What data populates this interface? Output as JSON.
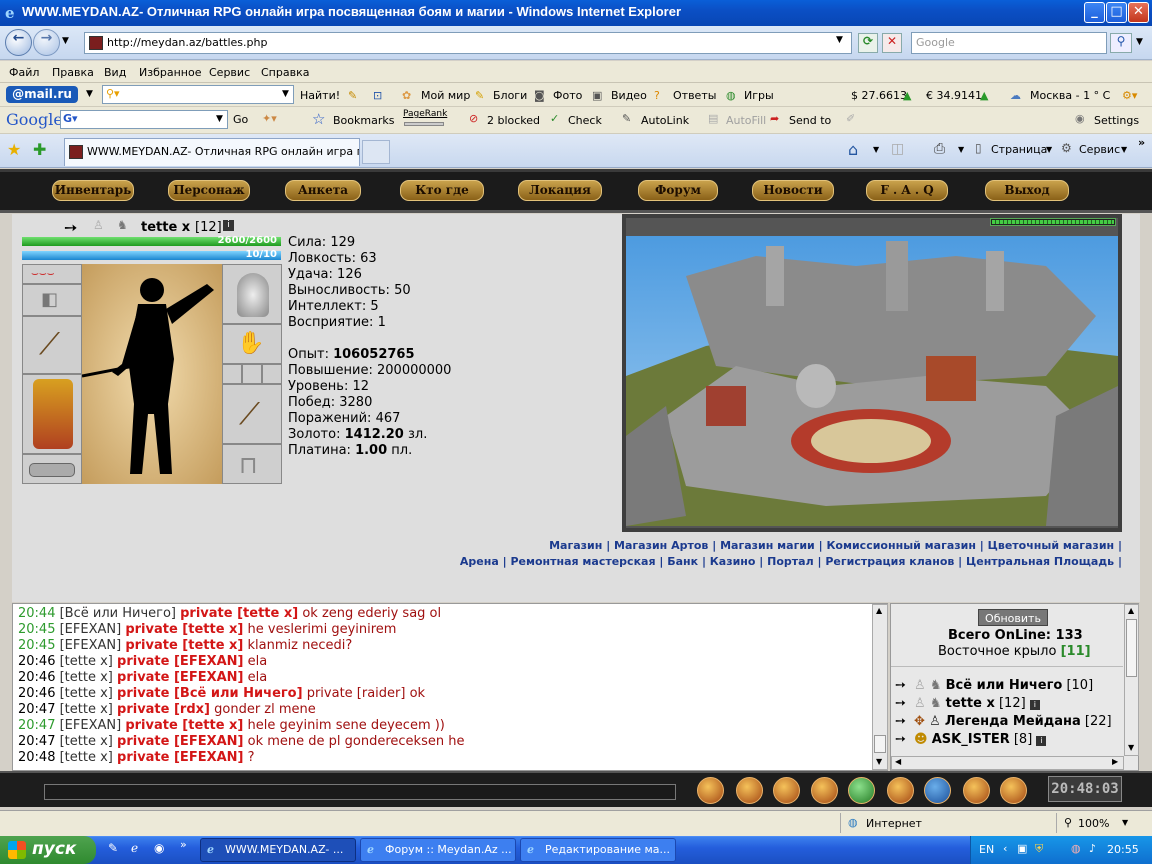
{
  "window": {
    "title": "WWW.MEYDAN.AZ- Отличная RPG онлайн игра посвященная боям и магии - Windows Internet Explorer"
  },
  "address": {
    "url": "http://meydan.az/battles.php",
    "search_placeholder": "Google"
  },
  "menu": [
    "Файл",
    "Правка",
    "Вид",
    "Избранное",
    "Сервис",
    "Справка"
  ],
  "mailru_bar": {
    "logo": "@mail.ru",
    "find_label": "Найти!",
    "items": [
      "Мой мир",
      "Блоги",
      "Фото",
      "Видео",
      "Ответы",
      "Игры"
    ],
    "usd": "$ 27.6613",
    "eur": "€ 34.9141",
    "weather": "Москва  - 1 ° C"
  },
  "google_bar": {
    "logo": "Google",
    "go": "Go",
    "bookmarks": "Bookmarks",
    "pagerank": "PageRank",
    "blocked": "2 blocked",
    "check": "Check",
    "autolink": "AutoLink",
    "autofill": "AutoFill",
    "sendto": "Send to",
    "settings": "Settings"
  },
  "tabs": {
    "active": "WWW.MEYDAN.AZ- Отличная RPG онлайн игра пос...",
    "right_items": [
      "Страница",
      "Сервис"
    ]
  },
  "game_nav": [
    "Инвентарь",
    "Персонаж",
    "Анкета",
    "Кто где",
    "Локация",
    "Форум",
    "Новости",
    "F . A . Q",
    "Выход"
  ],
  "character": {
    "name": "tette x",
    "level": "[12]",
    "hp_text": "2600/2600",
    "mp_text": "10/10",
    "hp_fraction": 1.0,
    "mp_fraction": 1.0,
    "stats": [
      {
        "label": "Сила:",
        "value": "129"
      },
      {
        "label": "Ловкость:",
        "value": "63"
      },
      {
        "label": "Удача:",
        "value": "126"
      },
      {
        "label": "Выносливость:",
        "value": "50"
      },
      {
        "label": "Интеллект:",
        "value": "5"
      },
      {
        "label": "Восприятие:",
        "value": "1"
      }
    ],
    "exp_label": "Опыт:",
    "exp": "106052765",
    "next_label": "Повышение:",
    "next": "200000000",
    "level_label": "Уровень:",
    "level_num": "12",
    "wins_label": "Побед:",
    "wins": "3280",
    "losses_label": "Поражений:",
    "losses": "467",
    "gold_label": "Золото:",
    "gold": "1412.20",
    "gold_unit": "зл.",
    "plat_label": "Платина:",
    "plat": "1.00",
    "plat_unit": "пл."
  },
  "links_row1": [
    "Магазин",
    "Магазин Артов",
    "Магазин магии",
    "Комиссионный магазин",
    "Цветочный магазин"
  ],
  "links_row2": [
    "Арена",
    "Ремонтная мастерская",
    "Банк",
    "Казино",
    "Портал",
    "Регистрация кланов",
    "Центральная Площадь"
  ],
  "chat": [
    {
      "time": "20:44",
      "green": true,
      "sender": "[Всё или Ничего]",
      "private": "private [tette x]",
      "msg": "ok zeng ederiy sag ol"
    },
    {
      "time": "20:45",
      "green": true,
      "sender": "[EFEXAN]",
      "private": "private [tette x]",
      "msg": "he veslerimi geyinirem"
    },
    {
      "time": "20:45",
      "green": true,
      "sender": "[EFEXAN]",
      "private": "private [tette x]",
      "msg": "klanmiz necedi?"
    },
    {
      "time": "20:46",
      "green": false,
      "sender": "[tette x]",
      "private": "private [EFEXAN]",
      "msg": "ela"
    },
    {
      "time": "20:46",
      "green": false,
      "sender": "[tette x]",
      "private": "private [EFEXAN]",
      "msg": "ela"
    },
    {
      "time": "20:46",
      "green": false,
      "sender": "[tette x]",
      "private": "private [Всё или Ничего]",
      "msg": "private [raider] ok"
    },
    {
      "time": "20:47",
      "green": false,
      "sender": "[tette x]",
      "private": "private [rdx]",
      "msg": "gonder zl mene"
    },
    {
      "time": "20:47",
      "green": true,
      "sender": "[EFEXAN]",
      "private": "private [tette x]",
      "msg": "hele geyinim sene deyecem ))"
    },
    {
      "time": "20:47",
      "green": false,
      "sender": "[tette x]",
      "private": "private [EFEXAN]",
      "msg": "ok mene de pl gondereceksen he"
    },
    {
      "time": "20:48",
      "green": false,
      "sender": "[tette x]",
      "private": "private [EFEXAN]",
      "msg": "?"
    }
  ],
  "online": {
    "refresh": "Обновить",
    "total_label": "Всего OnLine:",
    "total": "133",
    "location": "Восточное крыло",
    "location_count": "[11]",
    "players": [
      {
        "name": "Всё или Ничего",
        "level": "[10]"
      },
      {
        "name": "tette x",
        "level": "[12]"
      },
      {
        "name": "Легенда Мейдана",
        "level": "[22]"
      },
      {
        "name": "ASK_ISTER",
        "level": "[8]"
      }
    ]
  },
  "footer": {
    "clock": "20:48:03"
  },
  "statusbar": {
    "zone": "Интернет",
    "zoom": "100%"
  },
  "taskbar": {
    "start": "пуск",
    "tasks": [
      "WWW.MEYDAN.AZ- ...",
      "Форум :: Meydan.Az ...",
      "Редактирование ма..."
    ],
    "lang": "EN",
    "time": "20:55"
  }
}
